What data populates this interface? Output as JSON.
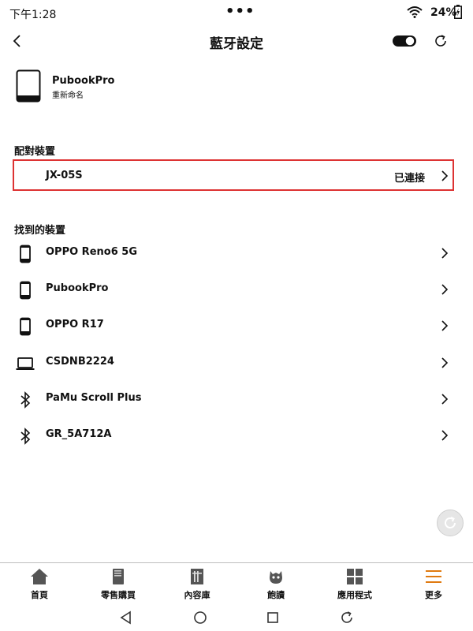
{
  "status_bar": {
    "time": "下午1:28",
    "dots": "•••",
    "battery": "24%"
  },
  "header": {
    "title": "藍牙設定"
  },
  "this_device": {
    "name": "PubookPro",
    "rename": "重新命名"
  },
  "sections": {
    "paired": "配對裝置",
    "found": "找到的裝置"
  },
  "paired": [
    {
      "name": "JX-05S",
      "status": "已連接"
    }
  ],
  "found": [
    {
      "name": "OPPO Reno6 5G",
      "icon": "phone-icon"
    },
    {
      "name": "PubookPro",
      "icon": "phone-icon"
    },
    {
      "name": "OPPO R17",
      "icon": "phone-icon"
    },
    {
      "name": "CSDNB2224",
      "icon": "laptop-icon"
    },
    {
      "name": "PaMu Scroll Plus",
      "icon": "bluetooth-icon"
    },
    {
      "name": "GR_5A712A",
      "icon": "bluetooth-icon"
    }
  ],
  "bottom_nav": [
    {
      "label": "首頁",
      "icon": "home-icon"
    },
    {
      "label": "零售購買",
      "icon": "book-icon"
    },
    {
      "label": "內容庫",
      "icon": "library-icon"
    },
    {
      "label": "飽讀",
      "icon": "reading-icon"
    },
    {
      "label": "應用程式",
      "icon": "apps-icon"
    },
    {
      "label": "更多",
      "icon": "menu-icon"
    }
  ],
  "colors": {
    "accent": "#e07a10",
    "highlight_border": "#dd3333"
  }
}
